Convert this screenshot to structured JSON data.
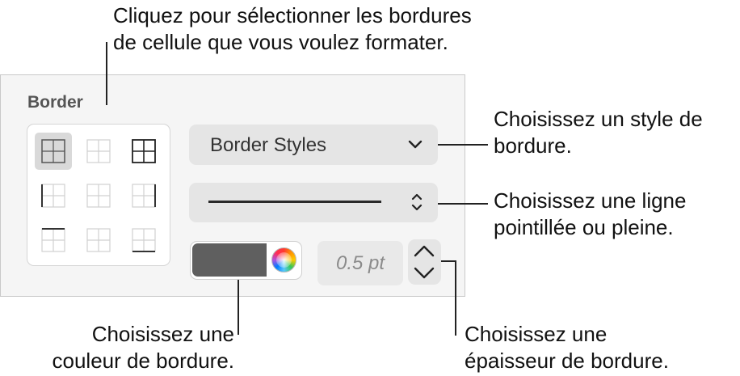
{
  "callouts": {
    "top": "Cliquez pour sélectionner les bordures\nde cellule que vous voulez formater.",
    "style": "Choisissez un style de\nbordure.",
    "line": "Choisissez une ligne\npointillée ou pleine.",
    "color": "Choisissez une\ncouleur de bordure.",
    "thickness": "Choisissez une\népaisseur de bordure."
  },
  "panel": {
    "section_title": "Border",
    "border_styles_label": "Border Styles",
    "width_value": "0.5 pt"
  },
  "border_grid": [
    {
      "name": "all-borders",
      "selected": true
    },
    {
      "name": "inside-borders",
      "selected": false
    },
    {
      "name": "outside-borders",
      "selected": false
    },
    {
      "name": "left-border",
      "selected": false
    },
    {
      "name": "inside-vertical",
      "selected": false
    },
    {
      "name": "right-border",
      "selected": false
    },
    {
      "name": "top-border",
      "selected": false
    },
    {
      "name": "inside-horizontal",
      "selected": false
    },
    {
      "name": "bottom-border",
      "selected": false
    }
  ],
  "colors": {
    "border_swatch": "#5f5f5f",
    "panel_bg": "#f5f5f5",
    "selected_cell_bg": "#d9d9d9"
  },
  "icons": {
    "dropdown": "chevron-down-icon",
    "popup": "up-down-chevron-icon",
    "stepper_up": "chevron-up-icon",
    "stepper_down": "chevron-down-icon",
    "color_picker": "color-wheel-icon"
  }
}
